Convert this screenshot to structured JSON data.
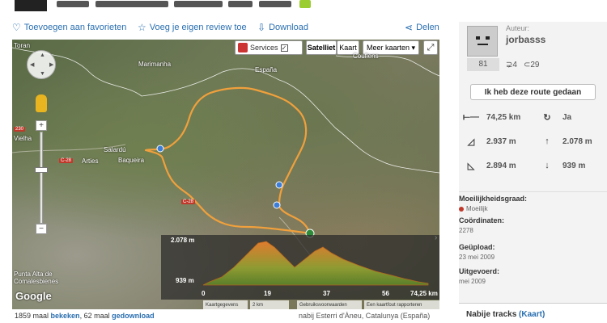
{
  "actions": {
    "favorites": "Toevoegen aan favorieten",
    "review": "Voeg je eigen review toe",
    "download": "Download",
    "share": "Delen"
  },
  "map": {
    "services": "Services",
    "satellite": "Satelliet",
    "map": "Kaart",
    "more": "Meer kaarten",
    "labels": {
      "toran": "Toran",
      "marimanha": "Marimanha",
      "espana": "España",
      "couflens": "Couflens",
      "vielha": "Vielha",
      "salardu": "Salardú",
      "baqueira": "Baqueira",
      "arties": "Arties",
      "punta_alta": "Punta Alta de",
      "comalesbienes": "Comalesbienes"
    },
    "roads": {
      "c230": "230",
      "c28": "C-28",
      "c28b": "C-28"
    },
    "google": "Google",
    "footer": {
      "kaartgegevens": "Kaartgegevens",
      "scale": "2 km",
      "terms": "Gebruiksvoorwaarden",
      "report": "Een kaartfout rapporteren"
    },
    "profile": {
      "max": "2.078 m",
      "min": "939 m",
      "ticks": [
        "0",
        "19",
        "37",
        "56",
        "74,25 km"
      ]
    }
  },
  "stats": {
    "views_prefix": "1859 maal ",
    "views_link": "bekeken",
    "downloads_prefix": ", 62 maal ",
    "downloads_link": "gedownload",
    "location": "nabij  Esterri d'Àneu, Catalunya (España)"
  },
  "sidebar": {
    "author_label": "Auteur:",
    "author_name": "jorbasss",
    "rank": "81",
    "followers": "4",
    "following": "29",
    "done_button": "Ik heb deze route gedaan",
    "distance": "74,25 km",
    "loop": "Ja",
    "elev_gain": "2.937 m",
    "max_alt": "2.078 m",
    "elev_loss": "2.894 m",
    "min_alt": "939 m",
    "difficulty_label": "Moeilijkheidsgraad:",
    "difficulty_value": "Moeilijk",
    "coords_label": "Coördinaten:",
    "coords_value": "2278",
    "uploaded_label": "Geüpload:",
    "uploaded_value": "23 mei 2009",
    "done_label": "Uitgevoerd:",
    "done_value": "mei 2009",
    "nearby": "Nabije tracks",
    "nearby_link": "(Kaart)"
  },
  "colors": {
    "link": "#2a6fb0",
    "route": "#f0a03c",
    "profile_fill": "#9a8a3a"
  }
}
